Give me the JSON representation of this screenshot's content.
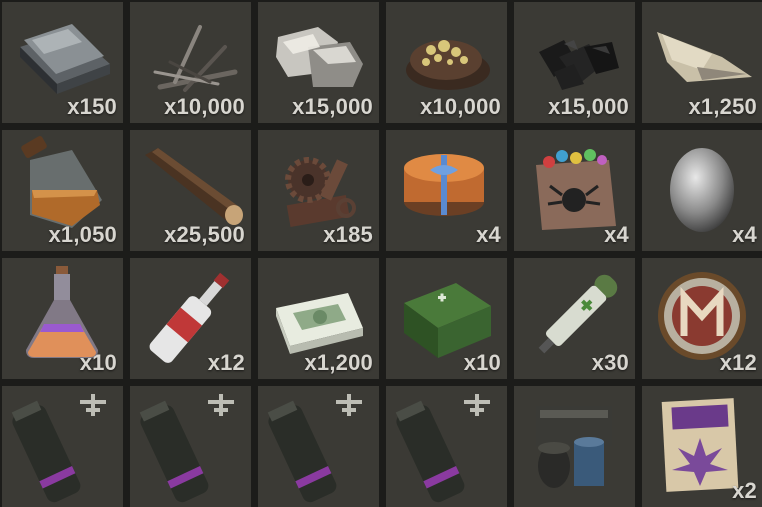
{
  "inventory": {
    "slots": [
      {
        "icon": "metal-fragments-icon",
        "quantity": "x150"
      },
      {
        "icon": "wood-sticks-icon",
        "quantity": "x10,000"
      },
      {
        "icon": "stones-icon",
        "quantity": "x15,000"
      },
      {
        "icon": "sulfur-ore-icon",
        "quantity": "x10,000"
      },
      {
        "icon": "charcoal-icon",
        "quantity": "x15,000"
      },
      {
        "icon": "bone-fragments-icon",
        "quantity": "x1,250"
      },
      {
        "icon": "low-grade-fuel-jar-icon",
        "quantity": "x1,050"
      },
      {
        "icon": "wood-log-icon",
        "quantity": "x25,500"
      },
      {
        "icon": "scrap-gears-icon",
        "quantity": "x185"
      },
      {
        "icon": "present-box-icon",
        "quantity": "x4"
      },
      {
        "icon": "halloween-candy-bag-icon",
        "quantity": "x4"
      },
      {
        "icon": "metal-egg-icon",
        "quantity": "x4"
      },
      {
        "icon": "potion-flask-icon",
        "quantity": "x10"
      },
      {
        "icon": "vodka-bottle-icon",
        "quantity": "x12"
      },
      {
        "icon": "cash-stack-icon",
        "quantity": "x1,200"
      },
      {
        "icon": "medical-crate-icon",
        "quantity": "x10"
      },
      {
        "icon": "medical-syringe-icon",
        "quantity": "x30"
      },
      {
        "icon": "token-coin-icon",
        "quantity": "x12"
      },
      {
        "icon": "supply-signal-grenade-icon",
        "quantity": ""
      },
      {
        "icon": "supply-signal-grenade-icon",
        "quantity": ""
      },
      {
        "icon": "supply-signal-grenade-icon",
        "quantity": ""
      },
      {
        "icon": "supply-signal-grenade-icon",
        "quantity": ""
      },
      {
        "icon": "barrel-workbench-icon",
        "quantity": ""
      },
      {
        "icon": "purple-haze-seeds-icon",
        "quantity": "x2"
      }
    ]
  },
  "colors": {
    "slot_bg": "#3b3a35",
    "grid_bg": "#1c1c1a",
    "quantity_text": "#d8d6d0"
  }
}
